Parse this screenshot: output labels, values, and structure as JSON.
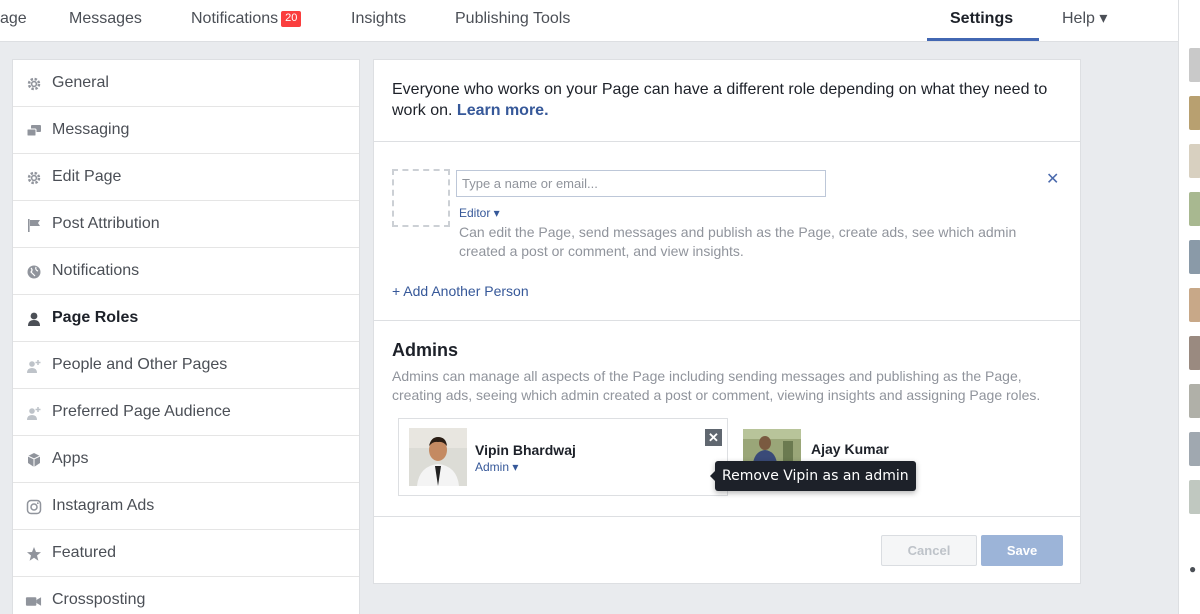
{
  "topnav": {
    "items": [
      {
        "label": "age"
      },
      {
        "label": "Messages"
      },
      {
        "label": "Notifications",
        "badge": "20"
      },
      {
        "label": "Insights"
      },
      {
        "label": "Publishing Tools"
      },
      {
        "label": "Settings",
        "active": true
      },
      {
        "label": "Help ▾"
      }
    ],
    "accent": "#4267b2",
    "badge_color": "#fa3e3e"
  },
  "sidebar": {
    "items": [
      {
        "label": "General",
        "icon": "gear-icon"
      },
      {
        "label": "Messaging",
        "icon": "chat-bubbles-icon"
      },
      {
        "label": "Edit Page",
        "icon": "gear-icon"
      },
      {
        "label": "Post Attribution",
        "icon": "flag-icon"
      },
      {
        "label": "Notifications",
        "icon": "globe-icon"
      },
      {
        "label": "Page Roles",
        "icon": "person-icon",
        "active": true
      },
      {
        "label": "People and Other Pages",
        "icon": "people-plus-icon"
      },
      {
        "label": "Preferred Page Audience",
        "icon": "people-plus-icon"
      },
      {
        "label": "Apps",
        "icon": "cube-icon"
      },
      {
        "label": "Instagram Ads",
        "icon": "instagram-icon"
      },
      {
        "label": "Featured",
        "icon": "star-icon"
      },
      {
        "label": "Crossposting",
        "icon": "video-camera-icon"
      }
    ]
  },
  "main": {
    "intro_text": "Everyone who works on your Page can have a different role depending on what they need to work on.",
    "learn_more": "Learn more.",
    "assign": {
      "input_placeholder": "Type a name or email...",
      "input_value": "",
      "role": "Editor ▾",
      "role_description": "Can edit the Page, send messages and publish as the Page, create ads, see which admin created a post or comment, and view insights.",
      "close": "✕",
      "add_another": "+ Add Another Person"
    },
    "admins": {
      "title": "Admins",
      "description": "Admins can manage all aspects of the Page including sending messages and publishing as the Page, creating ads, seeing which admin created a post or comment, viewing insights and assigning Page roles.",
      "people": [
        {
          "name": "Vipin Bhardwaj",
          "role": "Admin ▾",
          "remove": "✕"
        },
        {
          "name": "Ajay Kumar"
        }
      ],
      "tooltip": "Remove Vipin as an admin"
    },
    "buttons": {
      "cancel": "Cancel",
      "save": "Save"
    }
  }
}
